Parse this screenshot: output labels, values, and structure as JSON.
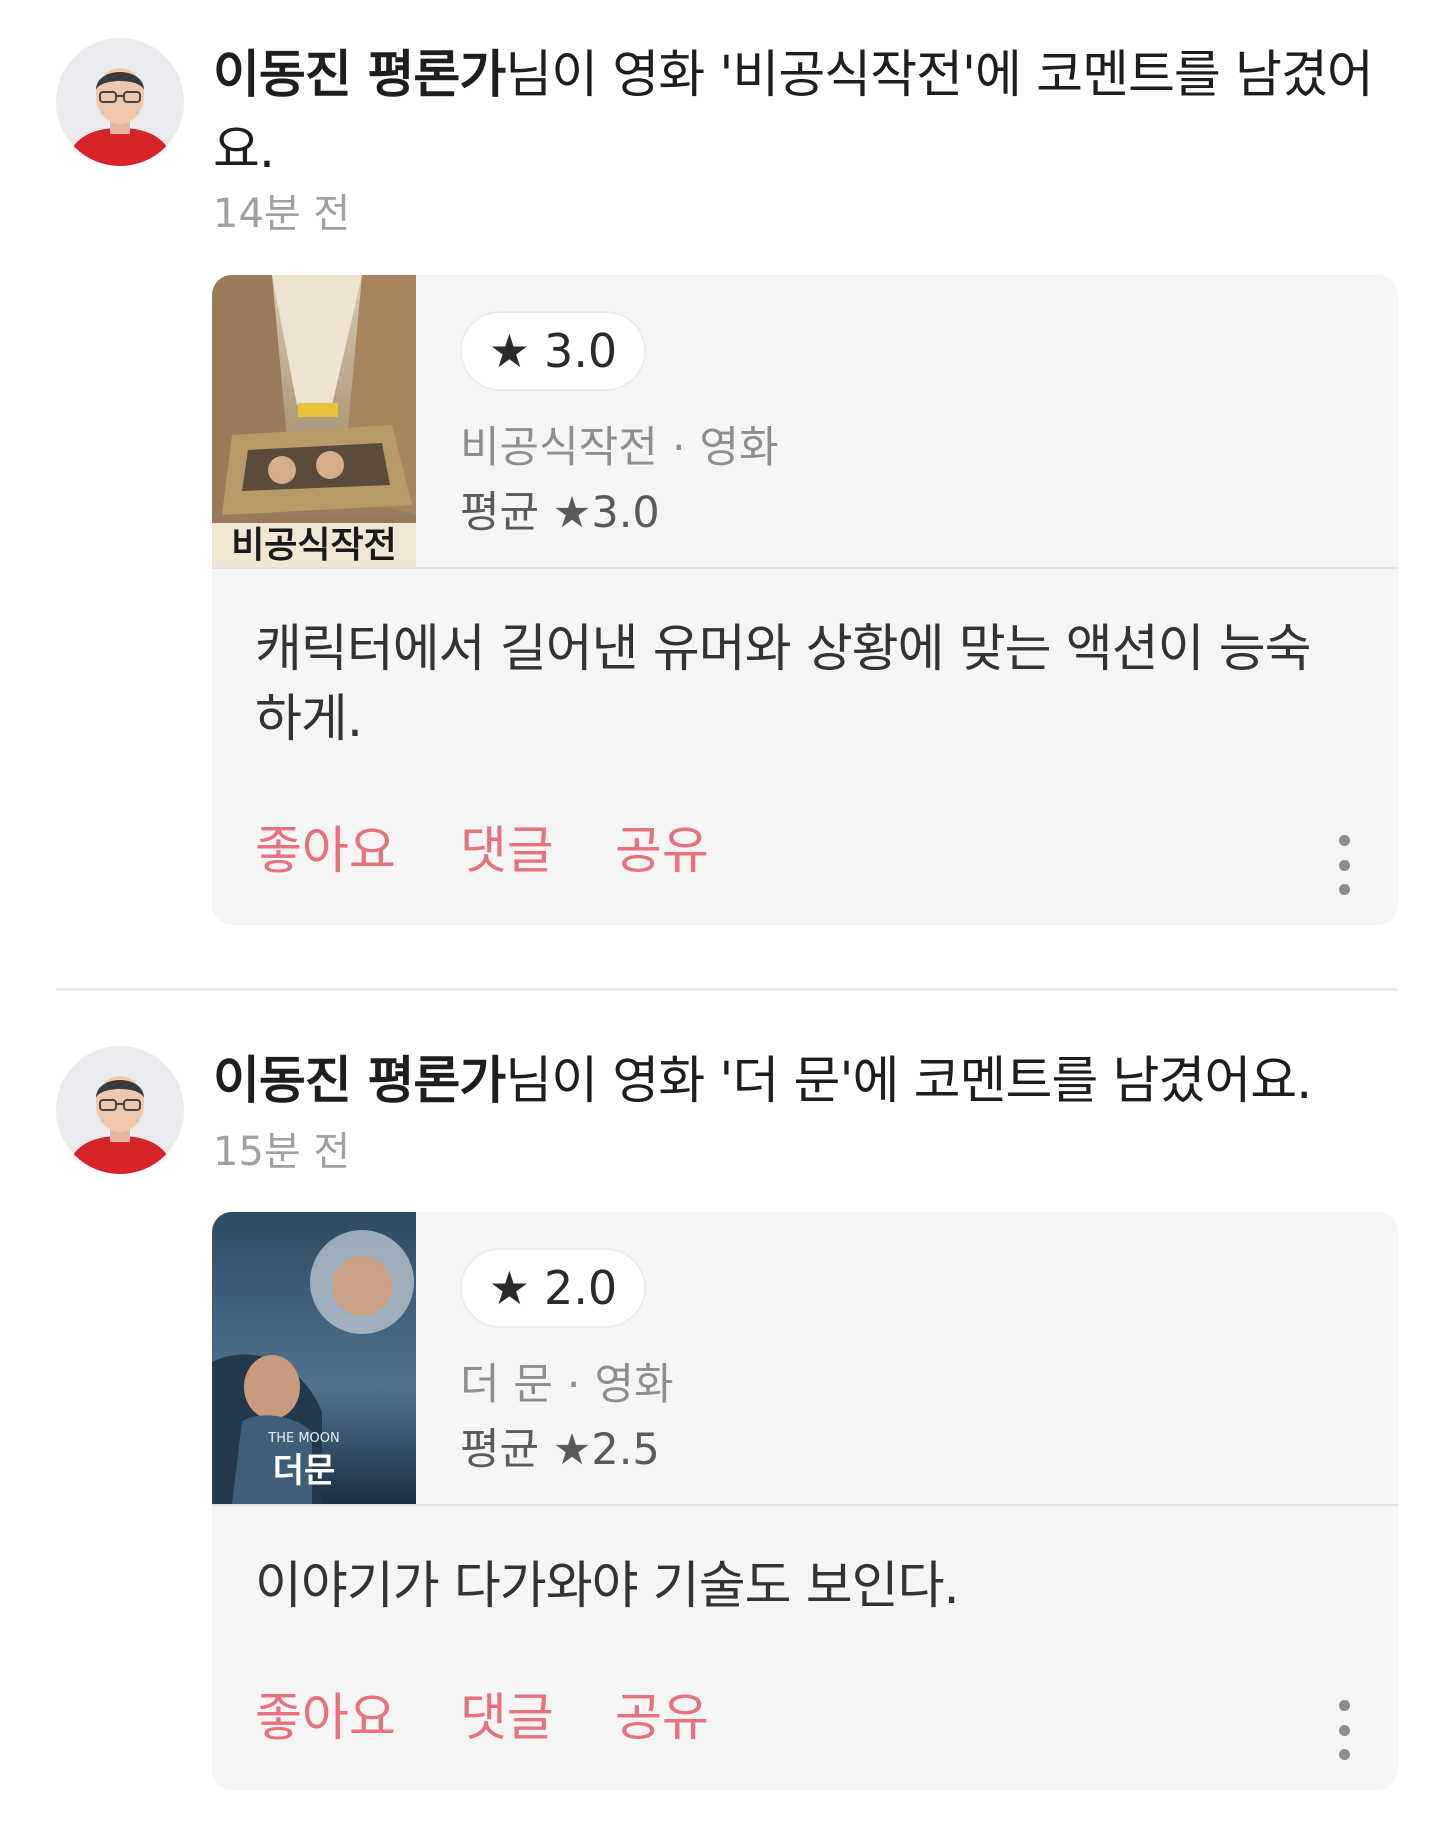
{
  "feed": [
    {
      "author": "이동진 평론가",
      "message": "님이 영화 '비공식작전'에 코멘트를 남겼어요.",
      "time": "14분 전",
      "rating": "3.0",
      "movie_title": "비공식작전",
      "movie_type": "영화",
      "average_label": "평균 ★3.0",
      "poster_text": "비공식작전",
      "comment": "캐릭터에서 길어낸 유머와 상황에 맞는 액션이 능숙하게.",
      "actions": {
        "like": "좋아요",
        "comment": "댓글",
        "share": "공유"
      }
    },
    {
      "author": "이동진 평론가",
      "message": "님이 영화 '더 문'에 코멘트를 남겼어요.",
      "time": "15분 전",
      "rating": "2.0",
      "movie_title": "더 문",
      "movie_type": "영화",
      "average_label": "평균 ★2.5",
      "poster_text": "더문",
      "poster_subtext": "THE MOON",
      "comment": "이야기가 다가와야 기술도 보인다.",
      "actions": {
        "like": "좋아요",
        "comment": "댓글",
        "share": "공유"
      }
    }
  ],
  "icons": {
    "star": "star-icon",
    "more": "more-vertical-icon"
  },
  "colors": {
    "accent": "#e8707f",
    "card_bg": "#f5f5f5",
    "muted": "#a0a0a0"
  }
}
